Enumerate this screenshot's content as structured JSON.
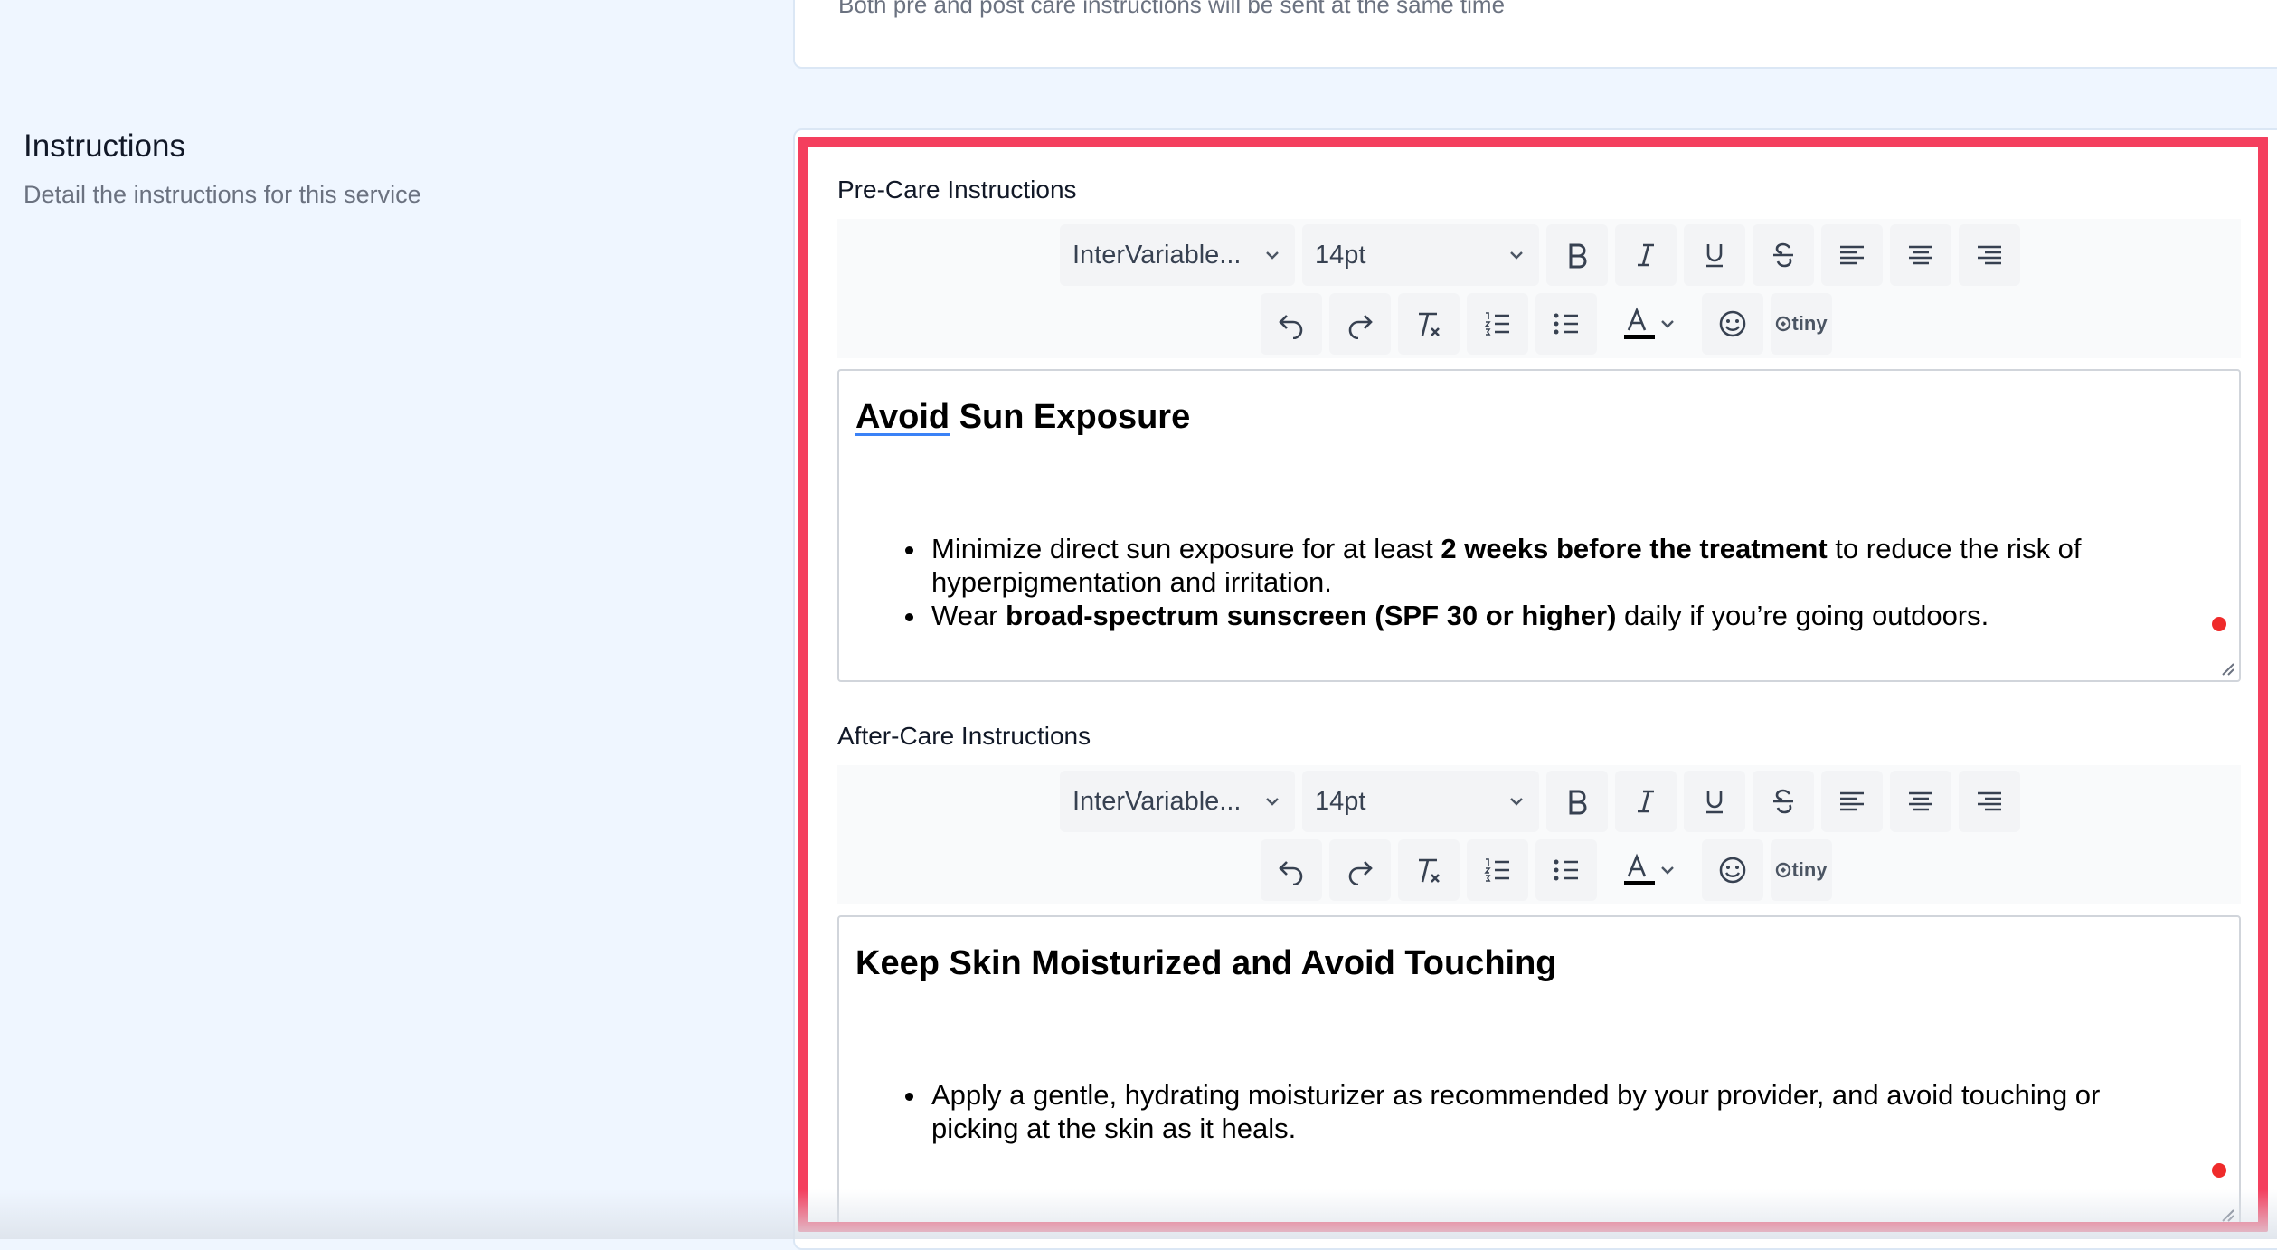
{
  "top_card": {
    "note": "Both pre and post care instructions will be sent at the same time"
  },
  "section": {
    "title": "Instructions",
    "description": "Detail the instructions for this service"
  },
  "toolbar": {
    "font_family": "InterVariable...",
    "font_size": "14pt",
    "tiny_label": "tiny",
    "icons": [
      "bold-icon",
      "italic-icon",
      "underline-icon",
      "strikethrough-icon",
      "align-left-icon",
      "align-center-icon",
      "align-right-icon",
      "undo-icon",
      "redo-icon",
      "clear-formatting-icon",
      "numbered-list-icon",
      "bullet-list-icon",
      "text-color-icon",
      "emoji-icon",
      "tiny-logo-icon"
    ]
  },
  "pre_care": {
    "label": "Pre-Care Instructions",
    "heading_word1": "Avoid",
    "heading_rest": " Sun Exposure",
    "items": [
      {
        "t1": "Minimize direct sun exposure for at least ",
        "b1": "2 weeks before the treatment",
        "t2": " to reduce the risk of hyperpigmentation and irritation."
      },
      {
        "t1": "Wear ",
        "b1": "broad-spectrum sunscreen (SPF 30 or higher)",
        "t2": " daily if you’re going outdoors."
      }
    ]
  },
  "after_care": {
    "label": "After-Care Instructions",
    "heading": "Keep Skin Moisturized and Avoid Touching",
    "items": [
      {
        "t1": "Apply a gentle, hydrating moisturizer as recommended by your provider, and avoid touching or picking at the skin as it heals."
      }
    ]
  },
  "colors": {
    "page_bg": "#eff6ff",
    "highlight": "#f43f5e",
    "dot": "#ef2b2b"
  }
}
